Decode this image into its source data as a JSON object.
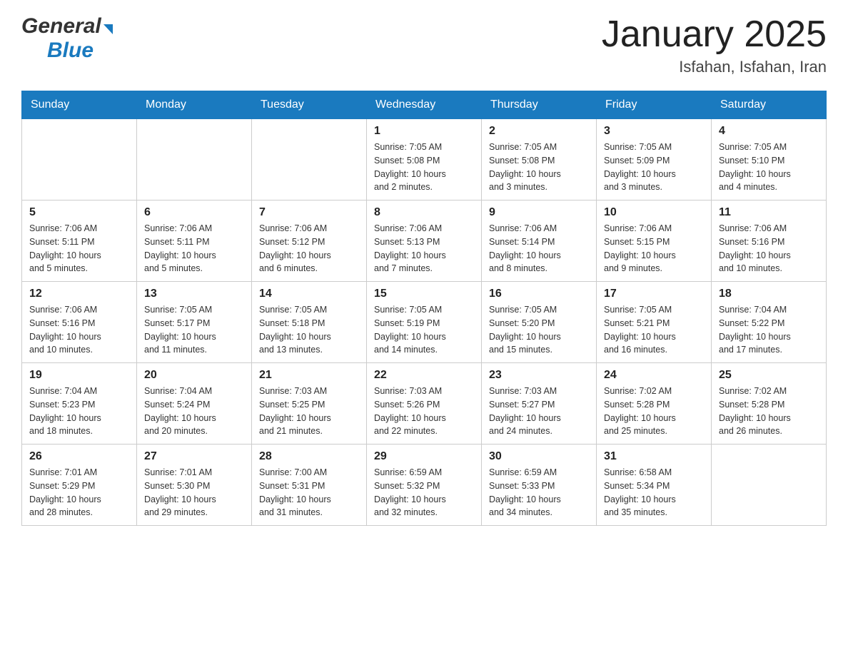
{
  "header": {
    "logo": {
      "general": "General",
      "blue": "Blue"
    },
    "title": "January 2025",
    "location": "Isfahan, Isfahan, Iran"
  },
  "calendar": {
    "days_of_week": [
      "Sunday",
      "Monday",
      "Tuesday",
      "Wednesday",
      "Thursday",
      "Friday",
      "Saturday"
    ],
    "weeks": [
      [
        {
          "day": "",
          "info": ""
        },
        {
          "day": "",
          "info": ""
        },
        {
          "day": "",
          "info": ""
        },
        {
          "day": "1",
          "info": "Sunrise: 7:05 AM\nSunset: 5:08 PM\nDaylight: 10 hours\nand 2 minutes."
        },
        {
          "day": "2",
          "info": "Sunrise: 7:05 AM\nSunset: 5:08 PM\nDaylight: 10 hours\nand 3 minutes."
        },
        {
          "day": "3",
          "info": "Sunrise: 7:05 AM\nSunset: 5:09 PM\nDaylight: 10 hours\nand 3 minutes."
        },
        {
          "day": "4",
          "info": "Sunrise: 7:05 AM\nSunset: 5:10 PM\nDaylight: 10 hours\nand 4 minutes."
        }
      ],
      [
        {
          "day": "5",
          "info": "Sunrise: 7:06 AM\nSunset: 5:11 PM\nDaylight: 10 hours\nand 5 minutes."
        },
        {
          "day": "6",
          "info": "Sunrise: 7:06 AM\nSunset: 5:11 PM\nDaylight: 10 hours\nand 5 minutes."
        },
        {
          "day": "7",
          "info": "Sunrise: 7:06 AM\nSunset: 5:12 PM\nDaylight: 10 hours\nand 6 minutes."
        },
        {
          "day": "8",
          "info": "Sunrise: 7:06 AM\nSunset: 5:13 PM\nDaylight: 10 hours\nand 7 minutes."
        },
        {
          "day": "9",
          "info": "Sunrise: 7:06 AM\nSunset: 5:14 PM\nDaylight: 10 hours\nand 8 minutes."
        },
        {
          "day": "10",
          "info": "Sunrise: 7:06 AM\nSunset: 5:15 PM\nDaylight: 10 hours\nand 9 minutes."
        },
        {
          "day": "11",
          "info": "Sunrise: 7:06 AM\nSunset: 5:16 PM\nDaylight: 10 hours\nand 10 minutes."
        }
      ],
      [
        {
          "day": "12",
          "info": "Sunrise: 7:06 AM\nSunset: 5:16 PM\nDaylight: 10 hours\nand 10 minutes."
        },
        {
          "day": "13",
          "info": "Sunrise: 7:05 AM\nSunset: 5:17 PM\nDaylight: 10 hours\nand 11 minutes."
        },
        {
          "day": "14",
          "info": "Sunrise: 7:05 AM\nSunset: 5:18 PM\nDaylight: 10 hours\nand 13 minutes."
        },
        {
          "day": "15",
          "info": "Sunrise: 7:05 AM\nSunset: 5:19 PM\nDaylight: 10 hours\nand 14 minutes."
        },
        {
          "day": "16",
          "info": "Sunrise: 7:05 AM\nSunset: 5:20 PM\nDaylight: 10 hours\nand 15 minutes."
        },
        {
          "day": "17",
          "info": "Sunrise: 7:05 AM\nSunset: 5:21 PM\nDaylight: 10 hours\nand 16 minutes."
        },
        {
          "day": "18",
          "info": "Sunrise: 7:04 AM\nSunset: 5:22 PM\nDaylight: 10 hours\nand 17 minutes."
        }
      ],
      [
        {
          "day": "19",
          "info": "Sunrise: 7:04 AM\nSunset: 5:23 PM\nDaylight: 10 hours\nand 18 minutes."
        },
        {
          "day": "20",
          "info": "Sunrise: 7:04 AM\nSunset: 5:24 PM\nDaylight: 10 hours\nand 20 minutes."
        },
        {
          "day": "21",
          "info": "Sunrise: 7:03 AM\nSunset: 5:25 PM\nDaylight: 10 hours\nand 21 minutes."
        },
        {
          "day": "22",
          "info": "Sunrise: 7:03 AM\nSunset: 5:26 PM\nDaylight: 10 hours\nand 22 minutes."
        },
        {
          "day": "23",
          "info": "Sunrise: 7:03 AM\nSunset: 5:27 PM\nDaylight: 10 hours\nand 24 minutes."
        },
        {
          "day": "24",
          "info": "Sunrise: 7:02 AM\nSunset: 5:28 PM\nDaylight: 10 hours\nand 25 minutes."
        },
        {
          "day": "25",
          "info": "Sunrise: 7:02 AM\nSunset: 5:28 PM\nDaylight: 10 hours\nand 26 minutes."
        }
      ],
      [
        {
          "day": "26",
          "info": "Sunrise: 7:01 AM\nSunset: 5:29 PM\nDaylight: 10 hours\nand 28 minutes."
        },
        {
          "day": "27",
          "info": "Sunrise: 7:01 AM\nSunset: 5:30 PM\nDaylight: 10 hours\nand 29 minutes."
        },
        {
          "day": "28",
          "info": "Sunrise: 7:00 AM\nSunset: 5:31 PM\nDaylight: 10 hours\nand 31 minutes."
        },
        {
          "day": "29",
          "info": "Sunrise: 6:59 AM\nSunset: 5:32 PM\nDaylight: 10 hours\nand 32 minutes."
        },
        {
          "day": "30",
          "info": "Sunrise: 6:59 AM\nSunset: 5:33 PM\nDaylight: 10 hours\nand 34 minutes."
        },
        {
          "day": "31",
          "info": "Sunrise: 6:58 AM\nSunset: 5:34 PM\nDaylight: 10 hours\nand 35 minutes."
        },
        {
          "day": "",
          "info": ""
        }
      ]
    ]
  }
}
